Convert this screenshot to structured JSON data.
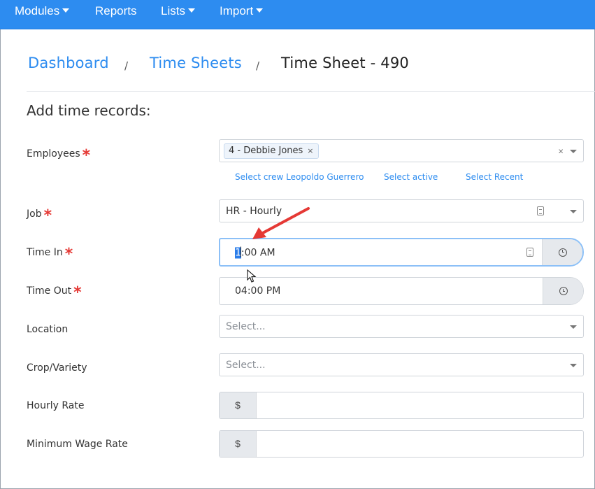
{
  "nav": {
    "modules": "Modules",
    "reports": "Reports",
    "lists": "Lists",
    "import": "Import"
  },
  "breadcrumb": {
    "dashboard": "Dashboard",
    "time_sheets": "Time Sheets",
    "current": "Time Sheet - 490",
    "separator": "/"
  },
  "section_title": "Add time records:",
  "required_mark": "*",
  "form": {
    "employees": {
      "label": "Employees",
      "selected_tag": "4 - Debbie Jones",
      "tag_remove": "×",
      "clear": "×",
      "quick_links": [
        "Select crew Leopoldo Guerrero",
        "Select active",
        "Select Recent"
      ]
    },
    "job": {
      "label": "Job",
      "value": "HR - Hourly"
    },
    "time_in": {
      "label": "Time In",
      "selected_digit": "1",
      "value_rest": ":00 AM"
    },
    "time_out": {
      "label": "Time Out",
      "value": "04:00 PM"
    },
    "location": {
      "label": "Location",
      "placeholder": "Select..."
    },
    "crop_variety": {
      "label": "Crop/Variety",
      "placeholder": "Select..."
    },
    "hourly_rate": {
      "label": "Hourly Rate",
      "prefix": "$",
      "value": ""
    },
    "minimum_wage_rate": {
      "label": "Minimum Wage Rate",
      "prefix": "$",
      "value": ""
    }
  },
  "colors": {
    "nav_bg": "#2d8cf0",
    "link": "#2d8cf0",
    "required": "#e53935",
    "annotation_arrow": "#e53935",
    "focus_border": "#8cc0f7"
  },
  "icons": {
    "dropdown": "chevron-down-icon",
    "clock": "clock-icon",
    "keyboard": "keyboard-icon",
    "annotation": "arrow-annotation-icon",
    "cursor": "mouse-cursor-icon"
  }
}
